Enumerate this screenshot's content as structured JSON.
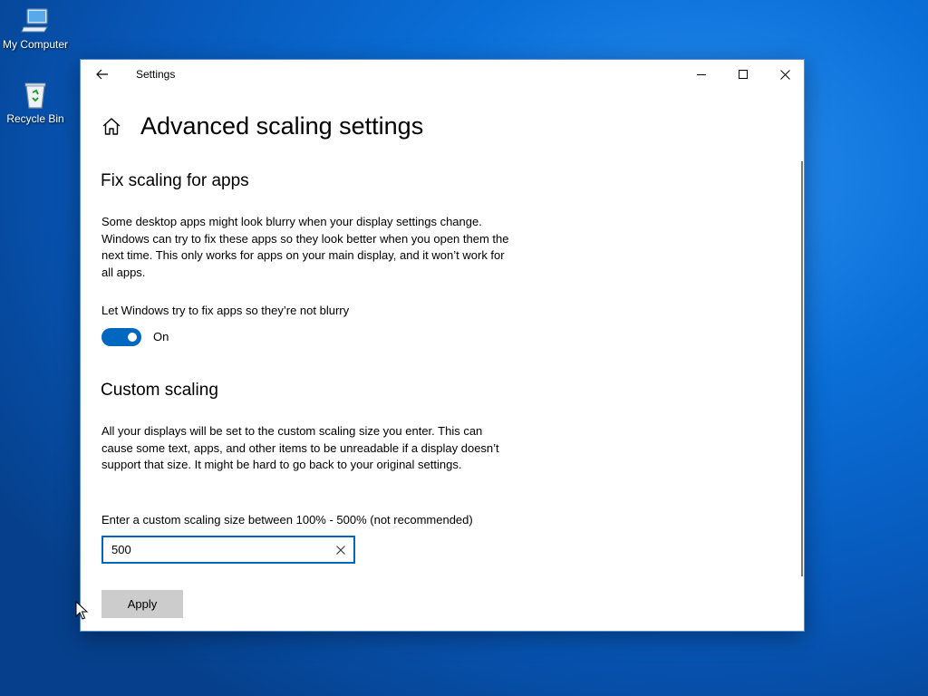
{
  "desktop": {
    "icons": [
      {
        "label": "My Computer",
        "icon": "computer-icon"
      },
      {
        "label": "Recycle Bin",
        "icon": "recycle-bin-icon"
      }
    ]
  },
  "window": {
    "title": "Settings",
    "buttons": {
      "back": "back-arrow-icon",
      "minimize": "minimize-icon",
      "maximize": "maximize-icon",
      "close": "close-icon"
    }
  },
  "page": {
    "title": "Advanced scaling settings",
    "home_icon": "home-icon"
  },
  "fix_scaling": {
    "heading": "Fix scaling for apps",
    "description": "Some desktop apps might look blurry when your display settings change. Windows can try to fix these apps so they look better when you open them the next time. This only works for apps on your main display, and it won’t work for all apps.",
    "toggle_label": "Let Windows try to fix apps so they’re not blurry",
    "toggle_state": "On",
    "toggle_on": true,
    "accent_color": "#0067c0"
  },
  "custom_scaling": {
    "heading": "Custom scaling",
    "description": "All your displays will be set to the custom scaling size you enter. This can cause some text, apps, and other items to be unreadable if a display doesn’t support that size. It might be hard to go back to your original settings.",
    "input_label": "Enter a custom scaling size between 100% - 500% (not recommended)",
    "input_value": "500",
    "apply_label": "Apply"
  }
}
